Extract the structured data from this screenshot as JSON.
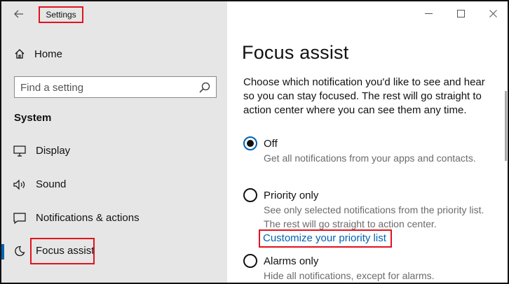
{
  "window": {
    "title": "Settings",
    "controls": {
      "minimize": "minimize-icon",
      "maximize": "maximize-icon",
      "close": "close-icon"
    }
  },
  "sidebar": {
    "back_icon": "back-arrow-icon",
    "home_label": "Home",
    "search": {
      "placeholder": "Find a setting",
      "value": ""
    },
    "section_title": "System",
    "items": [
      {
        "label": "Display",
        "icon": "display-icon"
      },
      {
        "label": "Sound",
        "icon": "sound-icon"
      },
      {
        "label": "Notifications & actions",
        "icon": "notifications-icon"
      },
      {
        "label": "Focus assist",
        "icon": "moon-icon",
        "active": true
      }
    ]
  },
  "main": {
    "title": "Focus assist",
    "intro": "Choose which notification you'd like to see and hear so you can stay focused. The rest will go straight to action center where you can see them any time.",
    "options": [
      {
        "label": "Off",
        "checked": true,
        "desc": "Get all notifications from your apps and contacts."
      },
      {
        "label": "Priority only",
        "checked": false,
        "desc": "See only selected notifications from the priority list. The rest will go straight to action center."
      },
      {
        "label": "Alarms only",
        "checked": false,
        "desc": "Hide all notifications, except for alarms."
      }
    ],
    "priority_link": "Customize your priority list"
  },
  "colors": {
    "accent": "#0063b1",
    "highlight_box": "#e0141e",
    "sidebar_bg": "#e6e6e6"
  }
}
